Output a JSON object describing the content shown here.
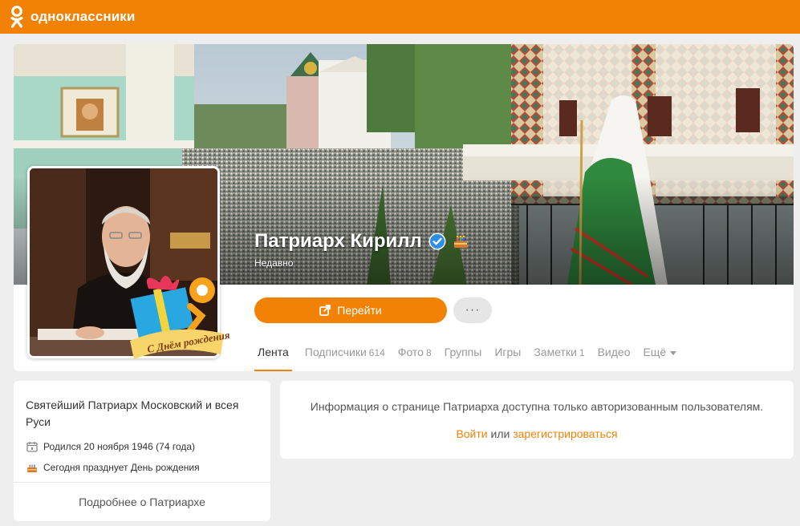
{
  "header": {
    "logo_text": "одноклассники",
    "brand_color": "#f18206"
  },
  "profile": {
    "name": "Патриарх Кирилл",
    "status": "Недавно",
    "verified_icon": "verified-badge-icon",
    "birthday_icon": "cake-icon",
    "avatar_banner_text": "С Днём рождения!"
  },
  "actions": {
    "go_label": "Перейти",
    "more_label": "···"
  },
  "tabs": [
    {
      "label": "Лента",
      "count": "",
      "active": true
    },
    {
      "label": "Подписчики",
      "count": "614"
    },
    {
      "label": "Фото",
      "count": "8"
    },
    {
      "label": "Группы",
      "count": ""
    },
    {
      "label": "Игры",
      "count": ""
    },
    {
      "label": "Заметки",
      "count": "1"
    },
    {
      "label": "Видео",
      "count": ""
    },
    {
      "label": "Ещё",
      "count": ""
    }
  ],
  "info": {
    "title": "Святейший Патриарх Московский и всея Руси",
    "born": "Родился 20 ноября 1946 (74 года)",
    "birthday_today": "Сегодня празднует День рождения",
    "more_label": "Подробнее о Патриархе"
  },
  "notice": {
    "text": "Информация о странице Патриарха доступна только авторизованным пользователям.",
    "login_label": "Войти",
    "or_label": "или",
    "register_label": "зарегистрироваться"
  }
}
